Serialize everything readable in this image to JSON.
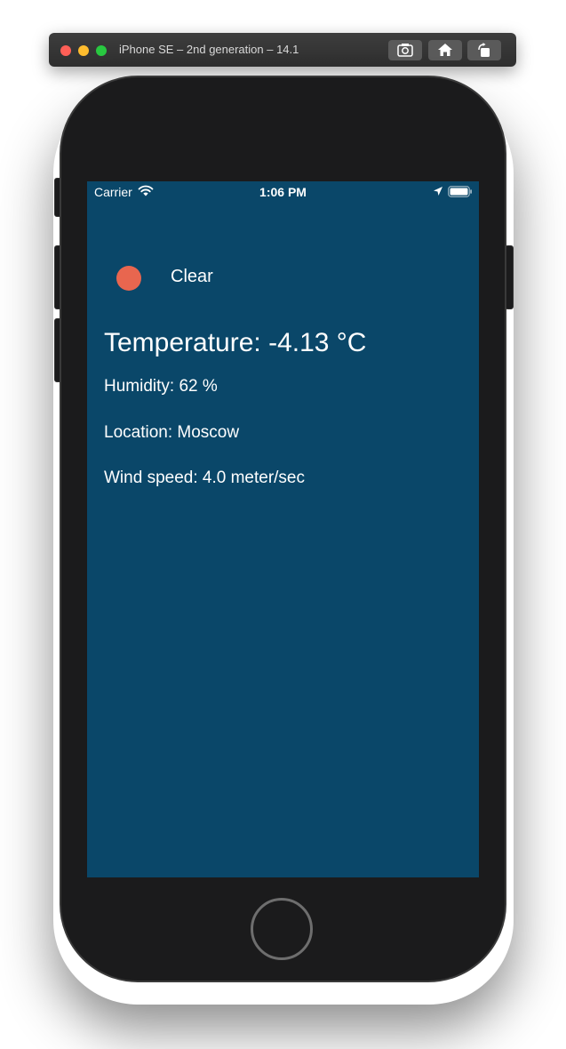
{
  "simulator": {
    "title": "iPhone SE – 2nd generation – 14.1"
  },
  "status_bar": {
    "carrier": "Carrier",
    "time": "1:06 PM"
  },
  "weather": {
    "condition": "Clear",
    "condition_color": "#e8664f",
    "temperature": "Temperature: -4.13 °C",
    "humidity": "Humidity: 62 %",
    "location": "Location: Moscow",
    "wind": "Wind speed: 4.0 meter/sec"
  },
  "colors": {
    "screen_background": "#0a4769",
    "device_body": "#1b1b1c"
  }
}
